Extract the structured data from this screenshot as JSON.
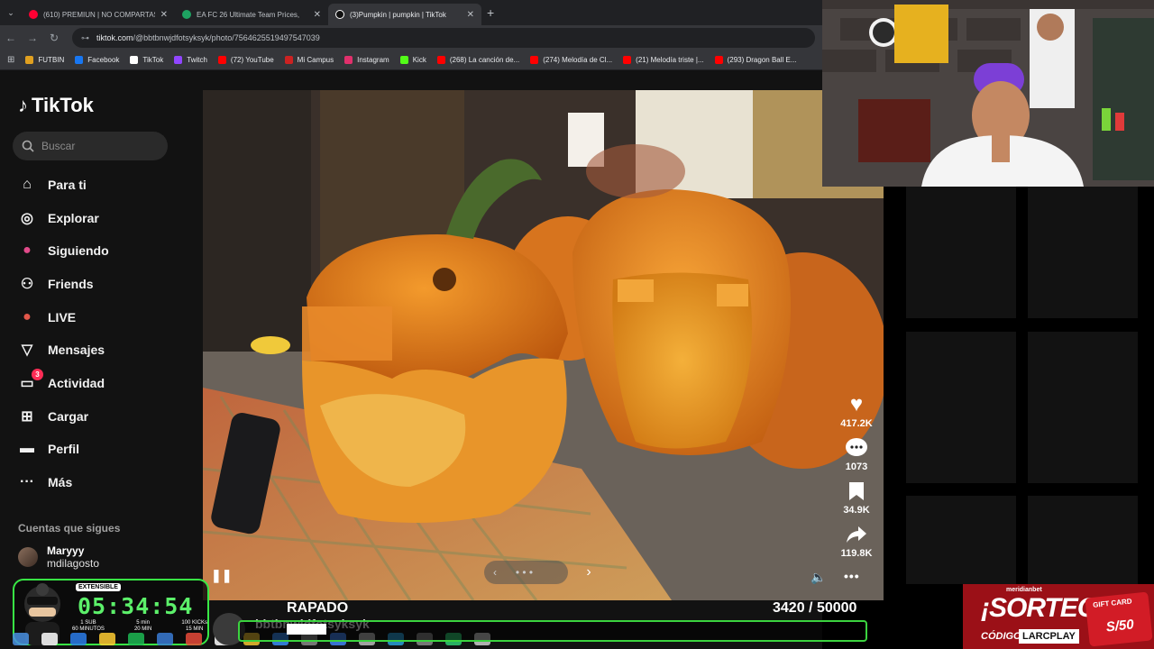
{
  "browser": {
    "tabs": [
      {
        "title": "(610) PREMIUN | NO COMPARTAS",
        "color": "#ff0033",
        "active": false
      },
      {
        "title": "EA FC 26 Ultimate Team Prices,",
        "color": "#1ea362",
        "active": false
      },
      {
        "title": "(3)Pumpkin | pumpkin | TikTok",
        "color": "#ffffff",
        "active": true
      }
    ],
    "url_host": "tiktok.com",
    "url_path": "/@bbtbnwjdfotsyksyk/photo/7564625519497547039",
    "bookmarks": [
      {
        "label": "FUTBIN",
        "color": "#e0a020"
      },
      {
        "label": "Facebook",
        "color": "#1877f2"
      },
      {
        "label": "TikTok",
        "color": "#ffffff"
      },
      {
        "label": "Twitch",
        "color": "#9146ff"
      },
      {
        "label": "(72) YouTube",
        "color": "#ff0000"
      },
      {
        "label": "Mi Campus",
        "color": "#cc2222"
      },
      {
        "label": "Instagram",
        "color": "#e1306c"
      },
      {
        "label": "Kick",
        "color": "#53fc18"
      },
      {
        "label": "(268) La canción de...",
        "color": "#ff0000"
      },
      {
        "label": "(274) Melodía de Cl...",
        "color": "#ff0000"
      },
      {
        "label": "(21) Melodía triste |...",
        "color": "#ff0000"
      },
      {
        "label": "(293) Dragon Ball E...",
        "color": "#ff0000"
      }
    ]
  },
  "tiktok": {
    "logo": "TikTok",
    "search_placeholder": "Buscar",
    "nav": [
      {
        "label": "Para ti",
        "icon": "home-icon",
        "glyph": "⌂"
      },
      {
        "label": "Explorar",
        "icon": "compass-icon",
        "glyph": "◎"
      },
      {
        "label": "Siguiendo",
        "icon": "following-avatar-icon",
        "glyph": "●"
      },
      {
        "label": "Friends",
        "icon": "friends-icon",
        "glyph": "⚇"
      },
      {
        "label": "LIVE",
        "icon": "live-avatar-icon",
        "glyph": "●"
      },
      {
        "label": "Mensajes",
        "icon": "paper-plane-icon",
        "glyph": "▽"
      },
      {
        "label": "Actividad",
        "icon": "activity-icon",
        "glyph": "▭",
        "badge": "3"
      },
      {
        "label": "Cargar",
        "icon": "upload-icon",
        "glyph": "⊞"
      },
      {
        "label": "Perfil",
        "icon": "profile-icon",
        "glyph": "▬"
      },
      {
        "label": "Más",
        "icon": "more-icon",
        "glyph": "···"
      }
    ],
    "following_header": "Cuentas que sigues",
    "following": [
      {
        "name": "Maryyy",
        "handle": "mdilagosto"
      }
    ],
    "actions": {
      "likes": "417.2K",
      "comments": "1073",
      "saves": "34.9K",
      "shares": "119.8K"
    },
    "carousel_dots": "• • •",
    "username_partial": "bbtbnwjdfotsyksyk"
  },
  "stream": {
    "timer": "05:34:54",
    "extensible_label": "EXTENSIBLE",
    "stats": [
      {
        "top": "1 SUB",
        "bottom": "60 MINUTOS"
      },
      {
        "top": "5 min",
        "bottom": "20 MIN"
      },
      {
        "top": "100 KICKs",
        "bottom": "15 MIN"
      }
    ],
    "goal_title": "RAPADO",
    "goal_current": "3420",
    "goal_target": "/ 50000",
    "goal_progress": 0.0684
  },
  "promo": {
    "brand": "meridianbet",
    "headline": "¡SORTEO!",
    "code_label": "CÓDIGO:",
    "code_value": "LARCPLAY",
    "card_title": "GIFT CARD",
    "card_value": "S/50"
  }
}
